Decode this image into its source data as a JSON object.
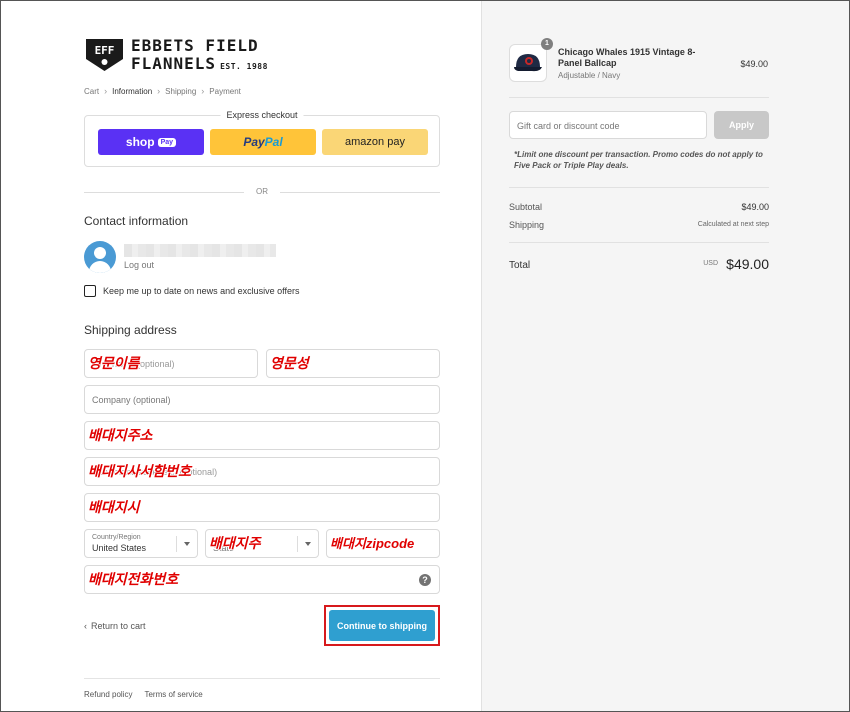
{
  "brand": {
    "name_line1": "EBBETS FIELD",
    "name_line2": "FLANNELS",
    "est": "EST. 1988",
    "badge": "EFF"
  },
  "breadcrumb": [
    "Cart",
    "Information",
    "Shipping",
    "Payment"
  ],
  "express": {
    "title": "Express checkout",
    "shop_label": "shop",
    "shop_pill": "Pay",
    "paypal_label_1": "Pay",
    "paypal_label_2": "Pal",
    "amazon_label": "amazon pay"
  },
  "or_label": "OR",
  "contact": {
    "title": "Contact information",
    "logout": "Log out",
    "newsletter_label": "Keep me up to date on news and exclusive offers"
  },
  "shipping": {
    "title": "Shipping address",
    "first_name_placeholder": "First name (optional)",
    "first_name_overlay": "영문이름",
    "last_name_overlay": "영문성",
    "company_placeholder": "Company (optional)",
    "address_overlay": "배대지주소",
    "apt_placeholder": "Apartment, suite, etc. (optional)",
    "apt_overlay": "배대지사서함번호",
    "city_overlay": "배대지시",
    "country_label": "Country/Region",
    "country_value": "United States",
    "state_placeholder": "State",
    "state_overlay": "배대지주",
    "zip_overlay": "배대지zipcode",
    "phone_overlay": "배대지전화번호",
    "help_icon": "?"
  },
  "actions": {
    "return_label": "Return to cart",
    "continue_label": "Continue to shipping"
  },
  "footer": {
    "refund": "Refund policy",
    "terms": "Terms of service"
  },
  "order": {
    "item_name": "Chicago Whales 1915 Vintage 8-Panel Ballcap",
    "item_variant": "Adjustable / Navy",
    "item_price": "$49.00",
    "item_qty": "1",
    "discount_placeholder": "Gift card or discount code",
    "apply_label": "Apply",
    "limit_note": "*Limit one discount per transaction. Promo codes do not apply to Five Pack or Triple Play deals.",
    "subtotal_label": "Subtotal",
    "subtotal_value": "$49.00",
    "shipping_label": "Shipping",
    "shipping_value": "Calculated at next step",
    "total_label": "Total",
    "currency": "USD",
    "total_value": "$49.00"
  },
  "colors": {
    "shop_pay": "#5a31f4",
    "paypal": "#ffc439",
    "amazon_pay": "#fad676",
    "continue": "#2f9fd0",
    "highlight_border": "#d7191c",
    "annotation_text": "#e00000"
  }
}
